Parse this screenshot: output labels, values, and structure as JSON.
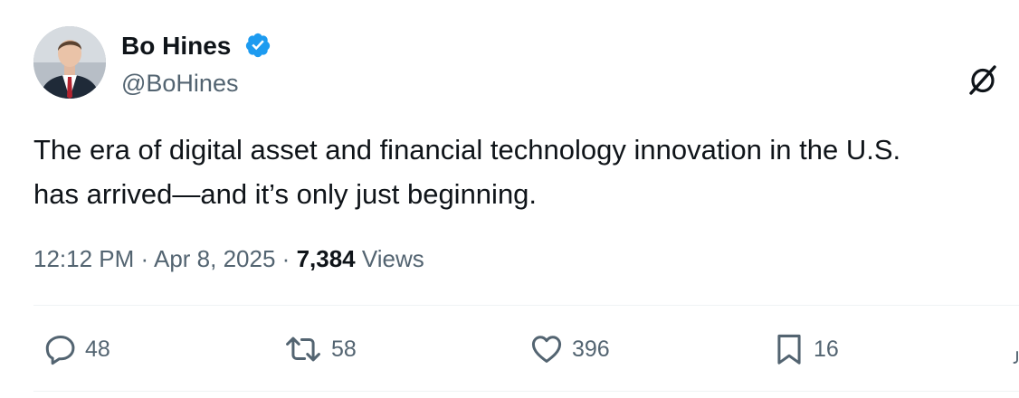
{
  "author": {
    "name": "Bo Hines",
    "handle": "@BoHines",
    "verified": true,
    "verified_color": "#1d9bf0"
  },
  "tweet": {
    "text_lines": [
      "The era of digital asset and financial technology innovation in the U.S.",
      "has arrived—and it’s only just beginning."
    ],
    "time": "12:12 PM",
    "date": "Apr 8, 2025",
    "separator": "·",
    "views_count": "7,384",
    "views_label": "Views"
  },
  "actions": {
    "reply_count": "48",
    "retweet_count": "58",
    "like_count": "396",
    "bookmark_count": "16"
  },
  "icons": {
    "avatar": "profile-photo",
    "verified": "verified-badge-icon",
    "grok": "grok-icon",
    "reply": "reply-icon",
    "retweet": "retweet-icon",
    "like": "heart-icon",
    "bookmark": "bookmark-icon",
    "share": "share-icon"
  },
  "colors": {
    "text_primary": "#0f1419",
    "text_secondary": "#536471",
    "divider": "#eff3f4"
  }
}
